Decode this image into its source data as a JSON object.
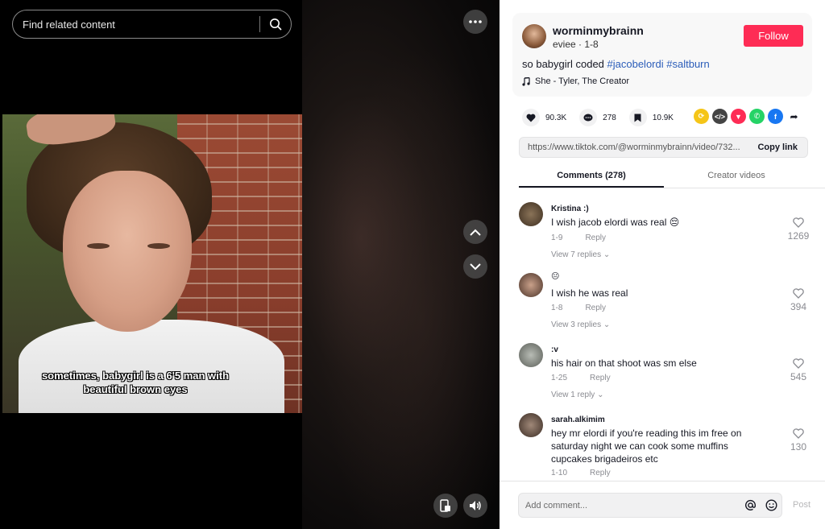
{
  "search": {
    "placeholder": "Find related content"
  },
  "video": {
    "caption": "sometimes, babygirl is a 6'5 man with beautiful brown eyes"
  },
  "author": {
    "username": "worminmybrainn",
    "nickname_date": "eviee · 1-8",
    "follow_label": "Follow",
    "description_prefix": "so babygirl coded ",
    "hashtags": [
      "#jacobelordi",
      "#saltburn"
    ],
    "music": "She - Tyler, The Creator"
  },
  "stats": {
    "likes": "90.3K",
    "comments": "278",
    "saves": "10.9K"
  },
  "link": {
    "url": "https://www.tiktok.com/@worminmybrainn/video/732...",
    "copy_label": "Copy link"
  },
  "tabs": [
    {
      "label": "Comments (278)",
      "active": true
    },
    {
      "label": "Creator videos",
      "active": false
    }
  ],
  "comments": [
    {
      "user": "Kristina :)",
      "text": "I wish jacob elordi was real 😔",
      "date": "1-9",
      "reply_label": "Reply",
      "likes": "1269",
      "replies": "View 7 replies"
    },
    {
      "user": "😐",
      "text": "I wish he was real",
      "date": "1-8",
      "reply_label": "Reply",
      "likes": "394",
      "replies": "View 3 replies"
    },
    {
      "user": ":v",
      "text": "his hair on that shoot was sm else",
      "date": "1-25",
      "reply_label": "Reply",
      "likes": "545",
      "replies": "View 1 reply"
    },
    {
      "user": "sarah.alkimim",
      "text": "hey mr elordi if you're reading this im free on saturday night we can cook some muffins cupcakes brigadeiros etc",
      "date": "1-10",
      "reply_label": "Reply",
      "likes": "130",
      "replies": ""
    }
  ],
  "composer": {
    "placeholder": "Add comment...",
    "post_label": "Post"
  },
  "colors": {
    "follow": "#fe2c55",
    "hashtag": "#2b5db9"
  },
  "share_icons": [
    "repost-icon",
    "embed-icon",
    "send-icon",
    "whatsapp-icon",
    "facebook-icon",
    "share-arrow-icon"
  ]
}
